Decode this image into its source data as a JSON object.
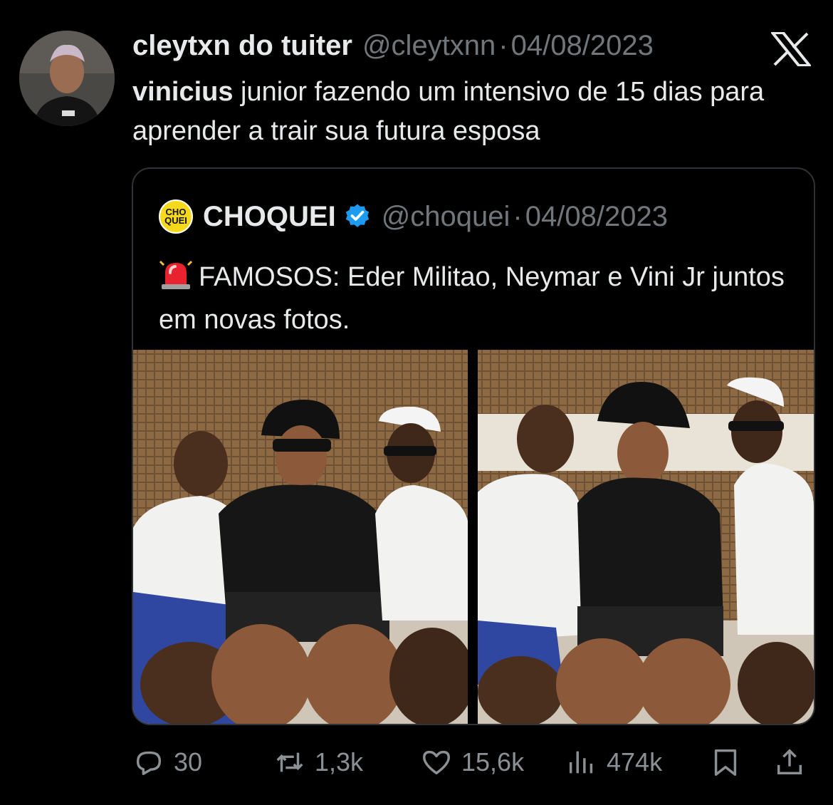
{
  "tweet": {
    "author_name": "cleytxn do tuiter",
    "author_handle": "@cleytxnn",
    "separator": "·",
    "date": "04/08/2023",
    "text_bold": "vinicius",
    "text_rest": " junior fazendo um intensivo de 15 dias para aprender a trair sua futura esposa",
    "avatar_icon": "user-avatar",
    "platform_icon": "x-logo-icon"
  },
  "quote": {
    "logo_text_line1": "CHO",
    "logo_text_line2": "QUEI",
    "author_name": "CHOQUEI",
    "verified_icon": "verified-badge-icon",
    "author_handle": "@choquei",
    "separator": "·",
    "date": "04/08/2023",
    "siren_icon": "siren-emoji-icon",
    "text": "FAMOSOS: Eder Militao, Neymar e Vini Jr juntos em novas fotos.",
    "photo_1": "photo-three-men-left",
    "photo_2": "photo-three-men-right"
  },
  "actions": {
    "replies": "30",
    "reposts": "1,3k",
    "likes": "15,6k",
    "views": "474k"
  },
  "colors": {
    "background": "#000000",
    "text_primary": "#e7e9ea",
    "text_secondary": "#71767b",
    "border": "#2f3336",
    "verified": "#1d9bf0",
    "logo_yellow": "#f6d91b"
  }
}
